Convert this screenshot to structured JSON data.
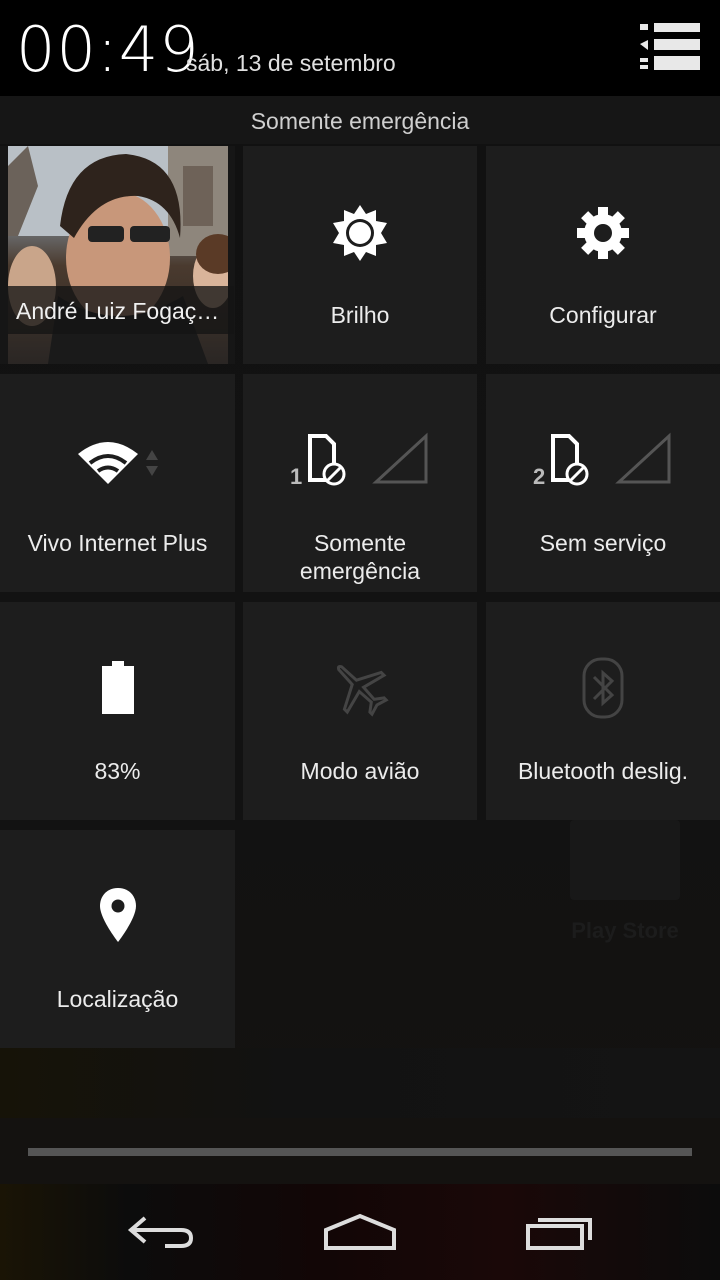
{
  "status": {
    "time": "00:49",
    "date": "sáb, 13 de setembro"
  },
  "emergency_banner": "Somente emergência",
  "tiles": {
    "user": {
      "label": "André Luiz Fogaç…"
    },
    "brightness": {
      "label": "Brilho",
      "icon": "sun-icon"
    },
    "settings": {
      "label": "Configurar",
      "icon": "gear-icon"
    },
    "wifi": {
      "label": "Vivo Internet Plus",
      "icon": "wifi-icon"
    },
    "sim1": {
      "label_line1": "Somente",
      "label_line2": "emergência",
      "slot": "1",
      "icon": "sim-icon"
    },
    "sim2": {
      "label": "Sem serviço",
      "slot": "2",
      "icon": "sim-icon"
    },
    "battery": {
      "label": "83%",
      "level": 0.83,
      "icon": "battery-icon"
    },
    "airplane": {
      "label": "Modo avião",
      "icon": "airplane-icon"
    },
    "bluetooth": {
      "label": "Bluetooth deslig.",
      "icon": "bluetooth-icon"
    },
    "location": {
      "label": "Localização",
      "icon": "location-pin-icon"
    }
  },
  "background_app": {
    "label": "Play Store"
  },
  "navigation": {
    "back": "back-icon",
    "home": "home-icon",
    "recents": "recents-icon"
  },
  "colors": {
    "tile_bg": "#1d1d1d",
    "text": "#ececec",
    "dim_icon": "#3a3a3a"
  }
}
